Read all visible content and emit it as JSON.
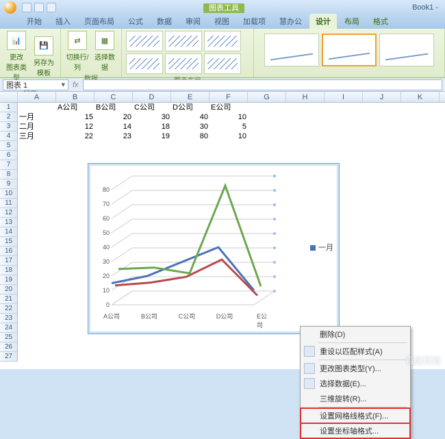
{
  "title_tools": "图表工具",
  "doc_name": "Book1 -",
  "tabs": [
    "开始",
    "插入",
    "页面布局",
    "公式",
    "数据",
    "审阅",
    "视图",
    "加载项",
    "慧办公"
  ],
  "ctx_tabs": [
    "设计",
    "布局",
    "格式"
  ],
  "ribbon": {
    "change_type": "更改\n图表类型",
    "save_tpl": "另存为\n模板",
    "switch": "切换行/列",
    "select_data": "选择数据",
    "g_type": "类型",
    "g_data": "数据",
    "g_layout": "图表布局"
  },
  "namebox": "图表 1",
  "columns": [
    "A",
    "B",
    "C",
    "D",
    "E",
    "F",
    "G",
    "H",
    "I",
    "J",
    "K"
  ],
  "row_count": 27,
  "table": {
    "row_headers": [
      "一月",
      "二月",
      "三月"
    ],
    "col_headers": [
      "A公司",
      "B公司",
      "C公司",
      "D公司",
      "E公司"
    ],
    "data": [
      [
        15,
        20,
        30,
        40,
        10
      ],
      [
        12,
        14,
        18,
        30,
        5
      ],
      [
        22,
        23,
        19,
        80,
        10
      ]
    ]
  },
  "chart_data": {
    "type": "line",
    "categories": [
      "A公司",
      "B公司",
      "C公司",
      "D公司",
      "E公司"
    ],
    "series": [
      {
        "name": "一月",
        "values": [
          15,
          20,
          30,
          40,
          10
        ],
        "color": "#4a72b8"
      },
      {
        "name": "二月",
        "values": [
          12,
          14,
          18,
          30,
          5
        ],
        "color": "#b84a4a"
      },
      {
        "name": "三月",
        "values": [
          22,
          23,
          19,
          80,
          10
        ],
        "color": "#6aa84f"
      }
    ],
    "ylim": [
      0,
      80
    ],
    "yticks": [
      0,
      10,
      20,
      30,
      40,
      50,
      60,
      70,
      80
    ],
    "legend_visible": [
      "一月"
    ]
  },
  "context_menu": {
    "items": [
      {
        "label": "删除(D)",
        "icon": false
      },
      {
        "label": "重设以匹配样式(A)",
        "icon": true
      },
      {
        "label": "更改图表类型(Y)...",
        "icon": true
      },
      {
        "label": "选择数据(E)...",
        "icon": true
      },
      {
        "label": "三维旋转(R)...",
        "icon": false
      },
      {
        "label": "设置网格线格式(F)...",
        "icon": false,
        "hl": true
      },
      {
        "label": "设置坐标轴格式...",
        "icon": false,
        "hl": true
      }
    ]
  },
  "watermark": "百度经验"
}
